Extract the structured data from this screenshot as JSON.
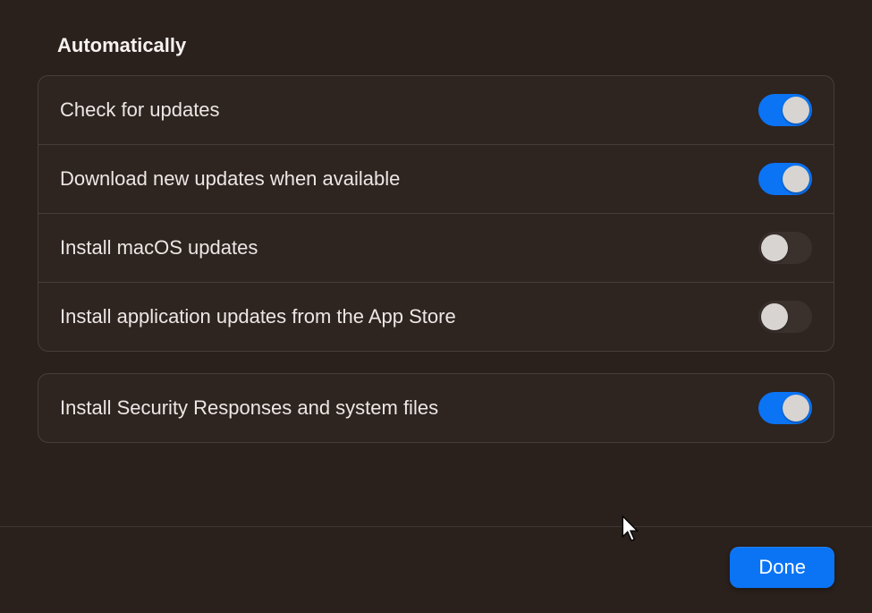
{
  "section_title": "Automatically",
  "group1": [
    {
      "label": "Check for updates",
      "on": true
    },
    {
      "label": "Download new updates when available",
      "on": true
    },
    {
      "label": "Install macOS updates",
      "on": false
    },
    {
      "label": "Install application updates from the App Store",
      "on": false
    }
  ],
  "group2": [
    {
      "label": "Install Security Responses and system files",
      "on": true
    }
  ],
  "done_label": "Done"
}
